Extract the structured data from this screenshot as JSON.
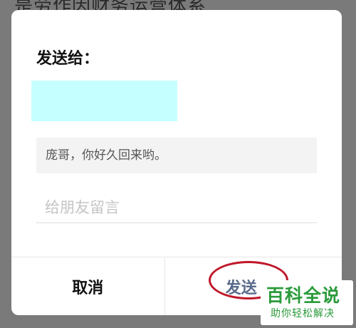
{
  "background": {
    "text": "是劳作因财务运营体系"
  },
  "dialog": {
    "title": "发送给：",
    "message_preview": "庞哥，你好久回来哟。",
    "comment_placeholder": "给朋友留言",
    "comment_value": "",
    "cancel_label": "取消",
    "send_label": "发送"
  },
  "watermark": {
    "main": "百科全说",
    "sub": "助你轻松解决"
  },
  "colors": {
    "recipient_block": "#c6ffff",
    "highlight_ring": "#c0182a",
    "watermark_green": "#2a9a3a",
    "overlay": "#7a7a7a"
  }
}
